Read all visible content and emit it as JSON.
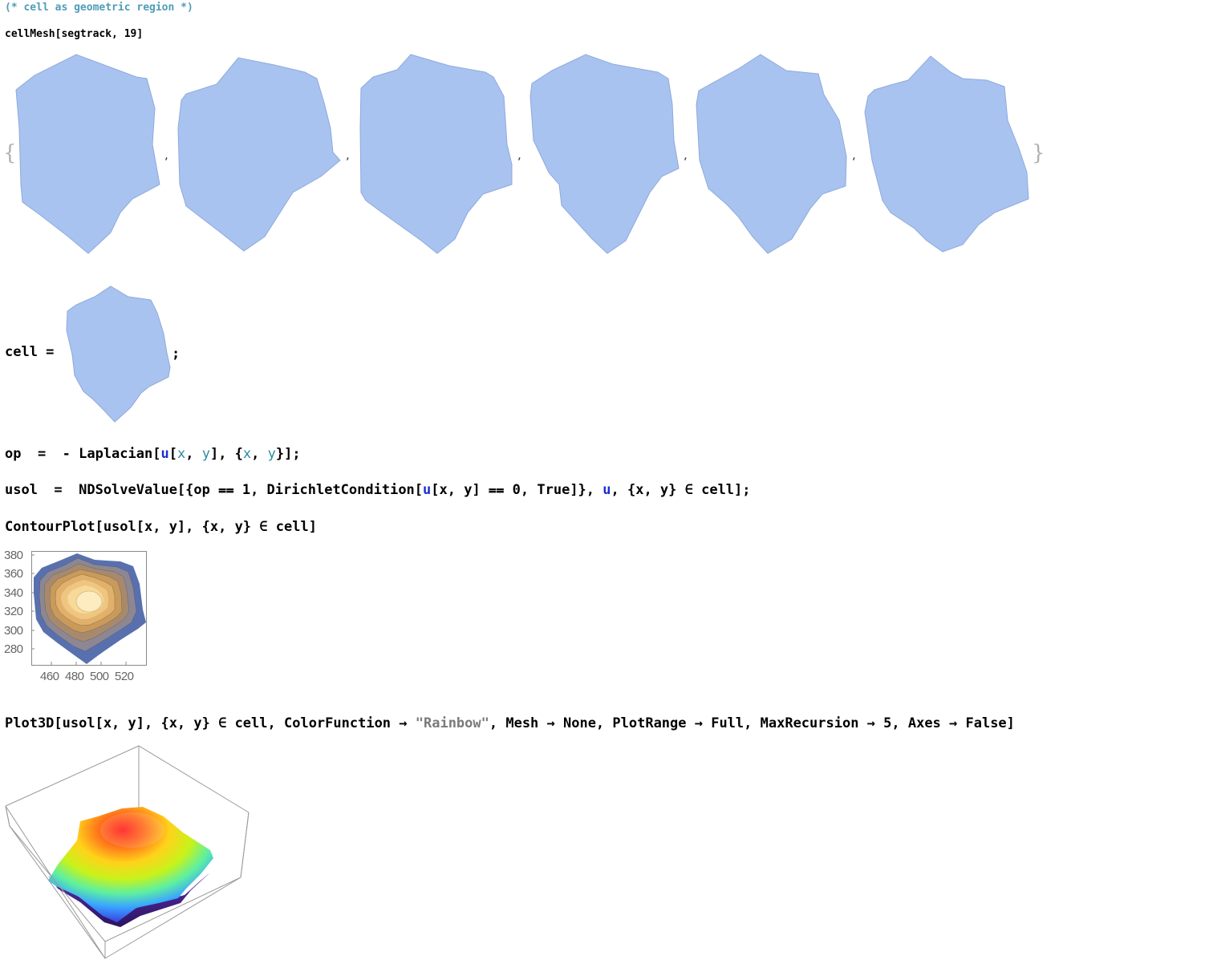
{
  "comment": {
    "open": "(* ",
    "text": "cell as geometric region",
    "close": " *)"
  },
  "cellmesh_input": "cellMesh[segtrack, 19]",
  "cell_assign": {
    "lhs": "cell =",
    "end": ";"
  },
  "list_open": "{",
  "list_close": "}",
  "list_sep": ",",
  "colors": {
    "region_fill": "#a9c3f0",
    "region_edge": "#8fa9dc",
    "comment": "#4f9cb8",
    "local_var": "#2b8c9e",
    "global_var": "#1a2fd1",
    "string": "#7a7a7a"
  },
  "lines": {
    "op": {
      "p1": "op  =  - Laplacian[",
      "u": "u",
      "p2": "[",
      "x": "x",
      "p3": ", ",
      "y": "y",
      "p4": "], {",
      "x2": "x",
      "p5": ", ",
      "y2": "y",
      "p6": "}];"
    },
    "usol": {
      "p1": "usol  =  NDSolveValue[{op ⩵ 1, DirichletCondition[",
      "u": "u",
      "p2": "[x, y] ⩵ 0, True]}, ",
      "u2": "u",
      "p3": ", {x, y} ∈ cell];"
    },
    "contour": "ContourPlot[usol[x, y], {x, y} ∈ cell]",
    "plot3d": {
      "p1": "Plot3D[usol[x, y], {x, y} ∈ cell, ColorFunction → ",
      "str": "\"Rainbow\"",
      "p2": ", Mesh → None, PlotRange → Full, MaxRecursion → 5, Axes → False]"
    }
  },
  "contour_plot": {
    "y_ticks": [
      "380",
      "360",
      "340",
      "320",
      "300",
      "280"
    ],
    "x_ticks": [
      "460",
      "480",
      "500",
      "520"
    ],
    "levels_colors": [
      "#5870ad",
      "#8c8793",
      "#a78a6e",
      "#c99a5a",
      "#e1b06b",
      "#efc681",
      "#f7da9a",
      "#fcecc0"
    ]
  },
  "plot3d": {
    "color_function": "Rainbow",
    "axes": false
  }
}
